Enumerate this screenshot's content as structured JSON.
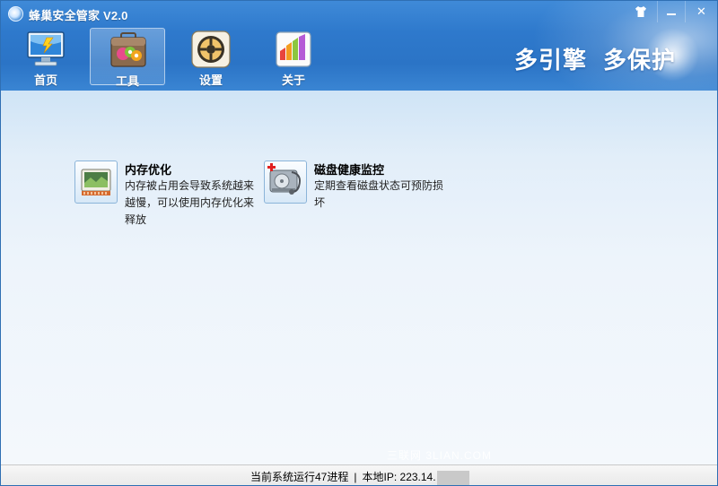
{
  "window": {
    "title": "蜂巢安全管家 V2.0"
  },
  "titlebar_buttons": {
    "skin_icon": "shirt-icon",
    "minimize_icon": "minimize-icon",
    "close_glyph": "✕"
  },
  "nav": {
    "items": [
      {
        "label": "首页",
        "icon": "monitor-icon"
      },
      {
        "label": "工具",
        "icon": "toolbox-icon"
      },
      {
        "label": "设置",
        "icon": "gear-icon"
      },
      {
        "label": "关于",
        "icon": "chart-card-icon"
      }
    ],
    "active_index": 1
  },
  "slogan": {
    "part1": "多引擎",
    "part2": "多保护"
  },
  "tools": [
    {
      "name": "内存优化",
      "description": "内存被占用会导致系统越来越慢，可以使用内存优化来释放",
      "icon": "memory-chip-icon"
    },
    {
      "name": "磁盘健康监控",
      "description": "定期查看磁盘状态可预防损坏",
      "icon": "disk-health-icon"
    }
  ],
  "watermark": "三联网 3LIAN.COM",
  "status": {
    "process_text": "当前系统运行47进程",
    "separator": "|",
    "ip_label": "本地IP:",
    "ip_value": "223.14."
  },
  "colors": {
    "header_blue": "#2e79cc",
    "content_bg": "#edf4fb"
  }
}
